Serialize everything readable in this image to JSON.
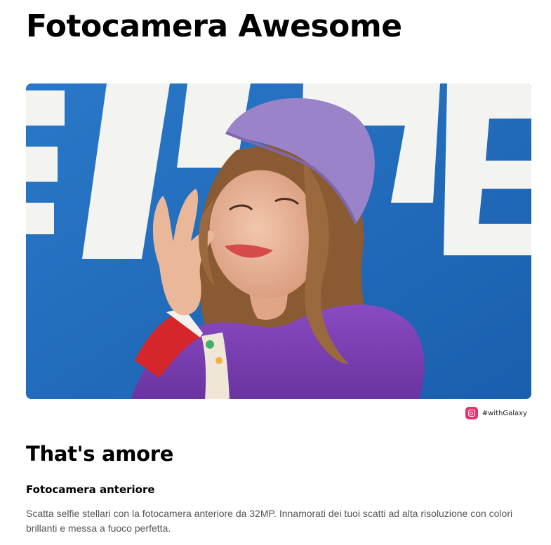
{
  "header": {
    "title": "Fotocamera Awesome"
  },
  "hero": {
    "image_description_icon": "selfie-photo",
    "colors": {
      "wall_blue": "#1f6fbf",
      "letter_white": "#f3f3f0",
      "beret": "#9b83c9",
      "sweater": "#7b3fb0",
      "hair": "#8a5a33",
      "skin": "#e9b79a"
    }
  },
  "social": {
    "icon": "instagram-icon",
    "label": "#withGalaxy",
    "accent": "#e2336b"
  },
  "section": {
    "title": "That's amore",
    "subtitle": "Fotocamera anteriore",
    "description": "Scatta selfie stellari con la fotocamera anteriore da 32MP. Innamorati dei tuoi scatti ad alta risoluzione con colori brillanti e messa a fuoco perfetta."
  }
}
